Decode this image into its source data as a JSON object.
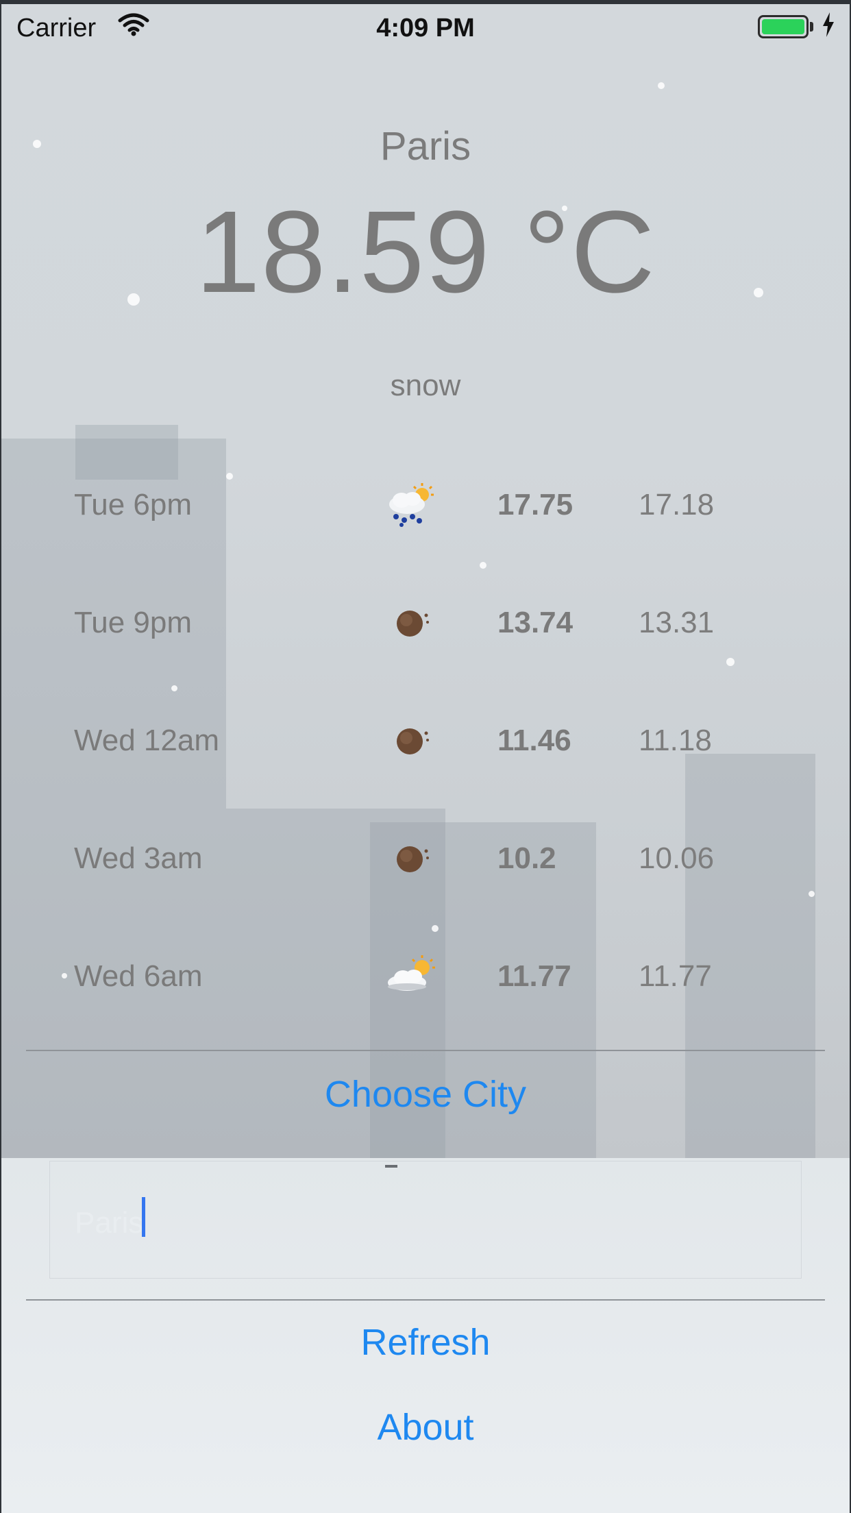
{
  "status_bar": {
    "carrier": "Carrier",
    "time": "4:09 PM",
    "battery_color": "#2bd25a"
  },
  "weather": {
    "city": "Paris",
    "temperature": "18.59 °C",
    "condition": "snow"
  },
  "forecast": [
    {
      "time": "Tue 6pm",
      "icon": "snow-showers-sun-icon",
      "max": "17.75",
      "min": "17.18"
    },
    {
      "time": "Tue 9pm",
      "icon": "night-moon-icon",
      "max": "13.74",
      "min": "13.31"
    },
    {
      "time": "Wed 12am",
      "icon": "night-moon-icon",
      "max": "11.46",
      "min": "11.18"
    },
    {
      "time": "Wed 3am",
      "icon": "night-moon-icon",
      "max": "10.2",
      "min": "10.06"
    },
    {
      "time": "Wed 6am",
      "icon": "cloud-sun-icon",
      "max": "11.77",
      "min": "11.77"
    }
  ],
  "actions": {
    "choose_city": "Choose City",
    "refresh": "Refresh",
    "about": "About"
  },
  "city_input": {
    "placeholder": "Paris"
  },
  "colors": {
    "link": "#1e88f0",
    "text": "#7a7a7a",
    "caret": "#3476f0"
  }
}
